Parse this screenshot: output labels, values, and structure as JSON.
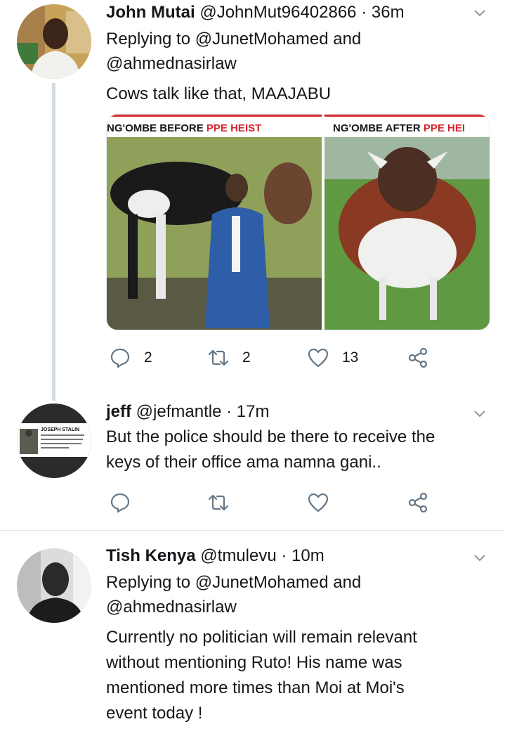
{
  "tweets": [
    {
      "name": "John Mutai",
      "handle": "@JohnMut96402866",
      "separator": "·",
      "time": "36m",
      "replying_prefix": "Replying to",
      "replying_1": "@JunetMohamed",
      "replying_and": "and",
      "replying_2": "@ahmednasirlaw",
      "text": "Cows talk like that, MAAJABU",
      "media": {
        "left_title_black": "NG'OMBE BEFORE",
        "left_title_red": "PPE HEIST",
        "right_title_black": "NG'OMBE AFTER",
        "right_title_red": "PPE HEI"
      },
      "replies": "2",
      "retweets": "2",
      "likes": "13"
    },
    {
      "name": "jeff",
      "handle": "@jefmantle",
      "separator": "·",
      "time": "17m",
      "text_line1": "But the police should be there to receive the",
      "text_line2": "keys of their office ama namna gani..",
      "avatar_caption_title": "JOSEPH STALIN",
      "avatar_caption_quote": "\"The people who cast the votes decide nothing. The people who count the votes decide everything.\""
    },
    {
      "name": "Tish Kenya",
      "handle": "@tmulevu",
      "separator": "·",
      "time": "10m",
      "replying_prefix": "Replying to",
      "replying_1": "@JunetMohamed",
      "replying_and": "and",
      "replying_2": "@ahmednasirlaw",
      "text_line1": "Currently no politician will remain relevant",
      "text_line2": "without mentioning Ruto! His name was",
      "text_line3": "mentioned more times than Moi at Moi's",
      "text_line4": "event today !"
    }
  ],
  "colors": {
    "icon": "#657786",
    "thread_line": "#d3dbe2",
    "red": "#d6252c"
  }
}
